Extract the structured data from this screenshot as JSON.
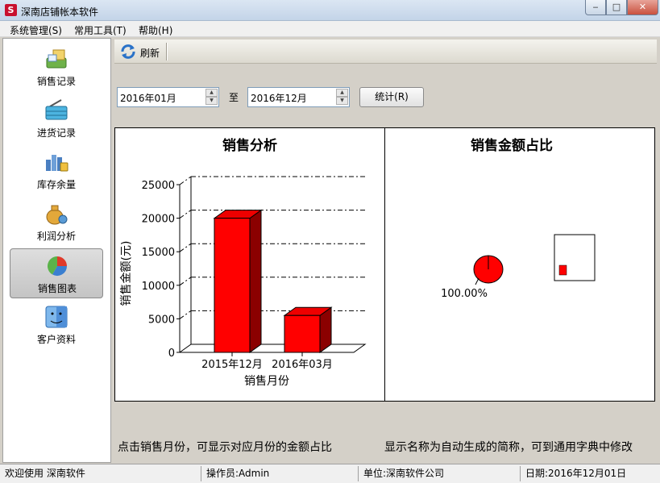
{
  "window": {
    "title": "深南店铺帐本软件",
    "app_icon_letter": "S",
    "min": "‒",
    "max": "□",
    "close": "✕"
  },
  "menu": [
    {
      "label": "系统管理(S)"
    },
    {
      "label": "常用工具(T)"
    },
    {
      "label": "帮助(H)"
    }
  ],
  "sidebar": {
    "items": [
      {
        "label": "销售记录",
        "icon": "sales-record-icon"
      },
      {
        "label": "进货记录",
        "icon": "purchase-basket-icon"
      },
      {
        "label": "库存余量",
        "icon": "inventory-icon"
      },
      {
        "label": "利润分析",
        "icon": "money-bag-icon"
      },
      {
        "label": "销售图表",
        "icon": "pie-chart-icon",
        "active": true
      },
      {
        "label": "客户资料",
        "icon": "finder-face-icon"
      }
    ]
  },
  "toolbar": {
    "refresh_label": "刷新"
  },
  "filter": {
    "start_date": "2016年01月",
    "end_date": "2016年12月",
    "to_label": "至",
    "stat_button": "统计(R)"
  },
  "bar_chart": {
    "chart_data": {
      "type": "bar",
      "title": "销售分析",
      "xlabel": "销售月份",
      "ylabel": "销售金额(元)",
      "categories": [
        "2015年12月",
        "2016年03月"
      ],
      "values": [
        20000,
        5500
      ],
      "ylim": [
        0,
        25000
      ],
      "yticks": [
        "0",
        "5000",
        "10000",
        "15000",
        "20000",
        "25000"
      ],
      "bar_color": "#ff0000",
      "grid": "dash-dot"
    }
  },
  "pie_chart": {
    "chart_data": {
      "type": "pie",
      "title": "销售金额占比",
      "slices": [
        {
          "value": 100.0,
          "color": "#ff0000"
        }
      ],
      "slice_label": "100.00%"
    }
  },
  "hints": {
    "left": "点击销售月份，可显示对应月份的金额占比",
    "right": "显示名称为自动生成的简称，可到通用字典中修改"
  },
  "status": {
    "welcome": "欢迎使用 深南软件",
    "operator": "操作员:Admin",
    "unit": "单位:深南软件公司",
    "date": "日期:2016年12月01日"
  }
}
